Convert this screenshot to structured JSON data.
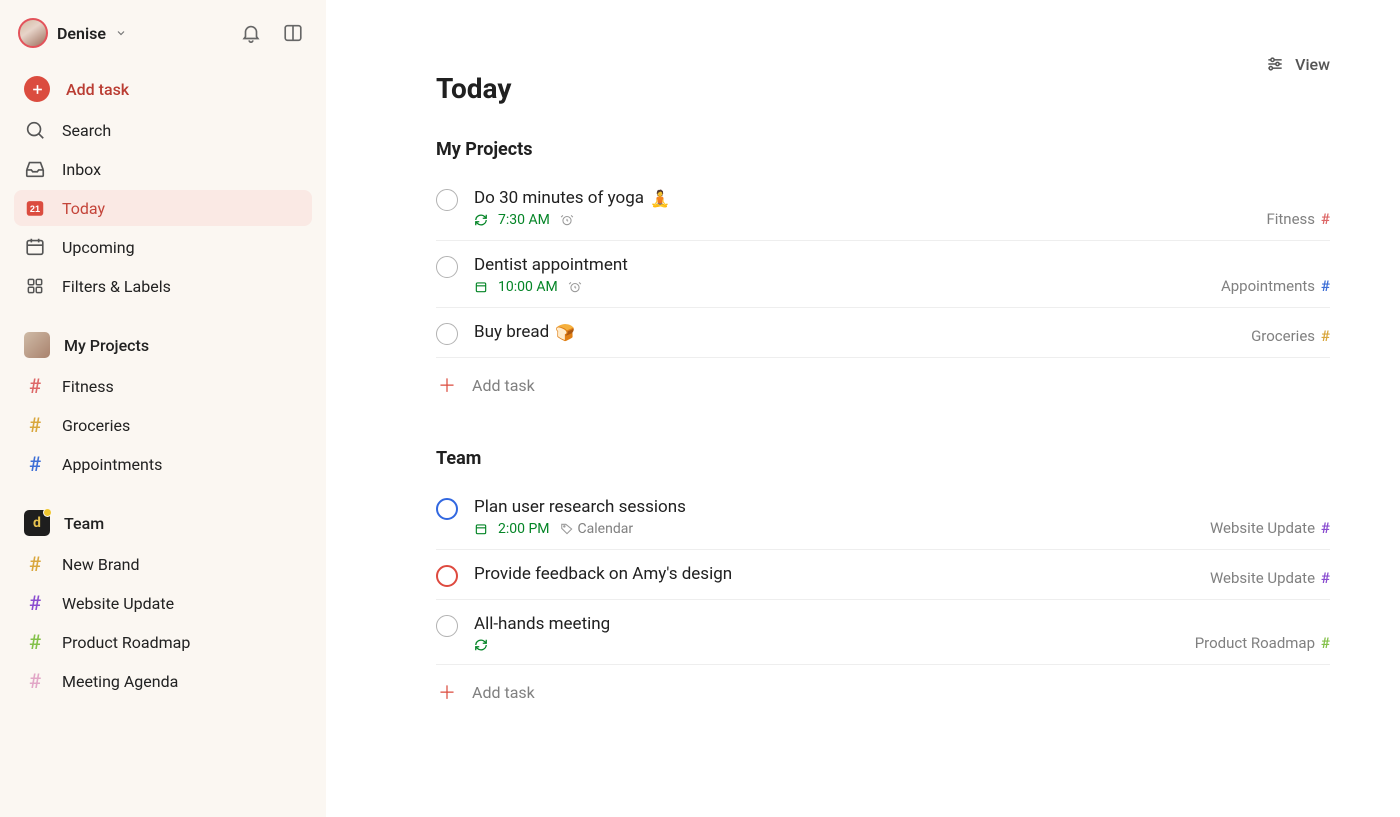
{
  "colors": {
    "accent": "#db4c3f",
    "sidebar_bg": "#fbf7f2",
    "active_bg": "#fae9e4",
    "fitness": "#dd6868",
    "groceries": "#d9a73e",
    "appointments": "#3e6fd6",
    "new_brand": "#d9a73e",
    "website_update": "#8a4dd0",
    "product_roadmap": "#84c14a",
    "meeting_agenda": "#e2a7c7",
    "time_green": "#058527"
  },
  "header": {
    "user_name": "Denise",
    "notifications_icon": "bell-icon",
    "panel_icon": "panel-icon"
  },
  "sidebar": {
    "add_task_label": "Add task",
    "nav": [
      {
        "key": "search",
        "label": "Search",
        "icon": "search-icon"
      },
      {
        "key": "inbox",
        "label": "Inbox",
        "icon": "inbox-icon"
      },
      {
        "key": "today",
        "label": "Today",
        "icon": "calendar-today-icon",
        "active": true,
        "badge": "21"
      },
      {
        "key": "upcoming",
        "label": "Upcoming",
        "icon": "calendar-upcoming-icon"
      },
      {
        "key": "filters",
        "label": "Filters & Labels",
        "icon": "grid-icon"
      }
    ],
    "sections": [
      {
        "key": "my_projects",
        "title": "My Projects",
        "avatar": "photo",
        "items": [
          {
            "label": "Fitness",
            "color_key": "fitness"
          },
          {
            "label": "Groceries",
            "color_key": "groceries"
          },
          {
            "label": "Appointments",
            "color_key": "appointments"
          }
        ]
      },
      {
        "key": "team",
        "title": "Team",
        "avatar": "team",
        "avatar_letter": "d",
        "items": [
          {
            "label": "New Brand",
            "color_key": "new_brand"
          },
          {
            "label": "Website Update",
            "color_key": "website_update"
          },
          {
            "label": "Product Roadmap",
            "color_key": "product_roadmap"
          },
          {
            "label": "Meeting Agenda",
            "color_key": "meeting_agenda"
          }
        ]
      }
    ]
  },
  "main": {
    "view_label": "View",
    "page_title": "Today",
    "add_task_label": "Add task",
    "groups": [
      {
        "title": "My Projects",
        "tasks": [
          {
            "title": "Do 30 minutes of yoga",
            "emoji": "🧘",
            "priority": "none",
            "time": "7:30 AM",
            "recurring": true,
            "has_reminder": true,
            "project": {
              "name": "Fitness",
              "color_key": "fitness"
            }
          },
          {
            "title": "Dentist appointment",
            "priority": "none",
            "time": "10:00 AM",
            "date_icon": true,
            "has_reminder": true,
            "project": {
              "name": "Appointments",
              "color_key": "appointments"
            }
          },
          {
            "title": "Buy bread",
            "emoji": "🍞",
            "priority": "none",
            "project": {
              "name": "Groceries",
              "color_key": "groceries"
            }
          }
        ]
      },
      {
        "title": "Team",
        "tasks": [
          {
            "title": "Plan user research sessions",
            "priority": "blue",
            "time": "2:00 PM",
            "date_icon": true,
            "label": "Calendar",
            "project": {
              "name": "Website Update",
              "color_key": "website_update"
            }
          },
          {
            "title": "Provide feedback on Amy's design",
            "priority": "red",
            "project": {
              "name": "Website Update",
              "color_key": "website_update"
            }
          },
          {
            "title": "All-hands meeting",
            "priority": "none",
            "recurring": true,
            "project": {
              "name": "Product Roadmap",
              "color_key": "product_roadmap"
            }
          }
        ]
      }
    ]
  }
}
